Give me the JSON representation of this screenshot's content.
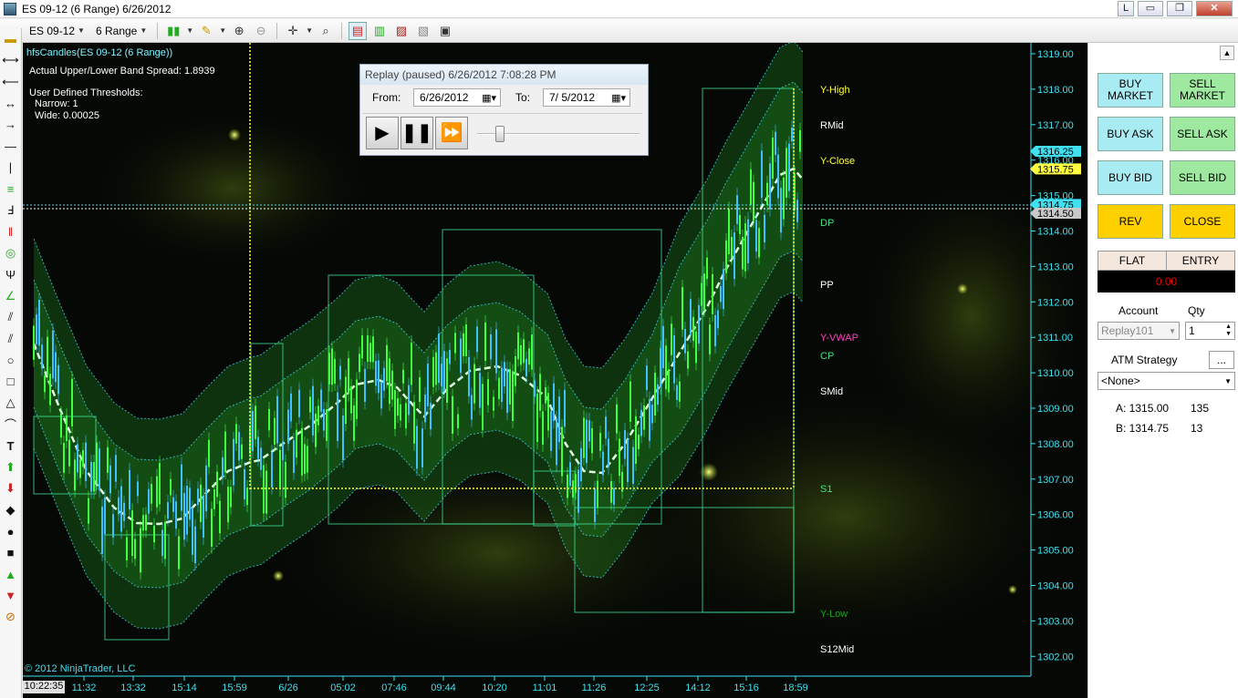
{
  "window": {
    "title": "ES 09-12 (6 Range)  6/26/2012",
    "buttons": [
      "L",
      "▭",
      "❐",
      "✕"
    ]
  },
  "toolbar": {
    "instrument": "ES 09-12",
    "interval": "6 Range"
  },
  "chart": {
    "indicator_title": "hfsCandles(ES 09-12 (6 Range))",
    "band_spread": "Actual Upper/Lower Band Spread: 1.8939",
    "thresholds_title": "User Defined Thresholds:",
    "narrow": "Narrow: 1",
    "wide": "Wide: 0.00025",
    "copyright": "© 2012 NinjaTrader, LLC",
    "current_time": "10:22:35",
    "time_labels": [
      "11:32",
      "13:32",
      "15:14",
      "15:59",
      "6/26",
      "05:02",
      "07:46",
      "09:44",
      "10:20",
      "11:01",
      "11:26",
      "12:25",
      "14:12",
      "15:16",
      "18:59"
    ],
    "price_labels": [
      "1319.00",
      "1318.00",
      "1317.00",
      "1316.00",
      "1315.00",
      "1314.00",
      "1313.00",
      "1312.00",
      "1311.00",
      "1310.00",
      "1309.00",
      "1308.00",
      "1307.00",
      "1306.00",
      "1305.00",
      "1304.00",
      "1303.00",
      "1302.00"
    ],
    "price_markers": [
      {
        "label": "1316.25",
        "color": "#40e0f0"
      },
      {
        "label": "1315.75",
        "color": "#ffff40"
      },
      {
        "label": "1314.75",
        "color": "#40e0f0"
      },
      {
        "label": "1314.50",
        "color": "#c8c8c8"
      }
    ],
    "level_labels": [
      {
        "name": "Y-High",
        "color": "#ffff40"
      },
      {
        "name": "RMid",
        "color": "#ffffff"
      },
      {
        "name": "Y-Close",
        "color": "#ffff40"
      },
      {
        "name": "DP",
        "color": "#40e080"
      },
      {
        "name": "PP",
        "color": "#ffffff"
      },
      {
        "name": "Y-VWAP",
        "color": "#ff40c0"
      },
      {
        "name": "CP",
        "color": "#40e080"
      },
      {
        "name": "SMid",
        "color": "#ffffff"
      },
      {
        "name": "S1",
        "color": "#40e080"
      },
      {
        "name": "Y-Low",
        "color": "#20a020"
      },
      {
        "name": "S12Mid",
        "color": "#ffffff"
      }
    ]
  },
  "replay": {
    "title": "Replay (paused) 6/26/2012 7:08:28 PM",
    "from_label": "From:",
    "from_value": "6/26/2012",
    "to_label": "To:",
    "to_value": "7/  5/2012",
    "speed_fraction": 0.12
  },
  "orders": {
    "buy_market": "BUY MARKET",
    "sell_market": "SELL MARKET",
    "buy_ask": "BUY ASK",
    "sell_ask": "SELL ASK",
    "buy_bid": "BUY BID",
    "sell_bid": "SELL BID",
    "rev": "REV",
    "close": "CLOSE",
    "flat": "FLAT",
    "entry": "ENTRY",
    "pnl": "0.00",
    "account_label": "Account",
    "qty_label": "Qty",
    "account_value": "Replay101",
    "qty_value": "1",
    "atm_label": "ATM Strategy",
    "atm_more": "...",
    "atm_value": "<None>",
    "ask_label": "A: 1315.00",
    "ask_size": "135",
    "bid_label": "B: 1314.75",
    "bid_size": "13"
  },
  "colors": {
    "chart_bg": "#050805",
    "axis": "#40e0f0",
    "candle_up": "#40c0ff",
    "candle_down": "#40ff40",
    "band_fill": "#208020",
    "mid_band": "#e0ffe0",
    "s1_line": "#ffff40"
  }
}
